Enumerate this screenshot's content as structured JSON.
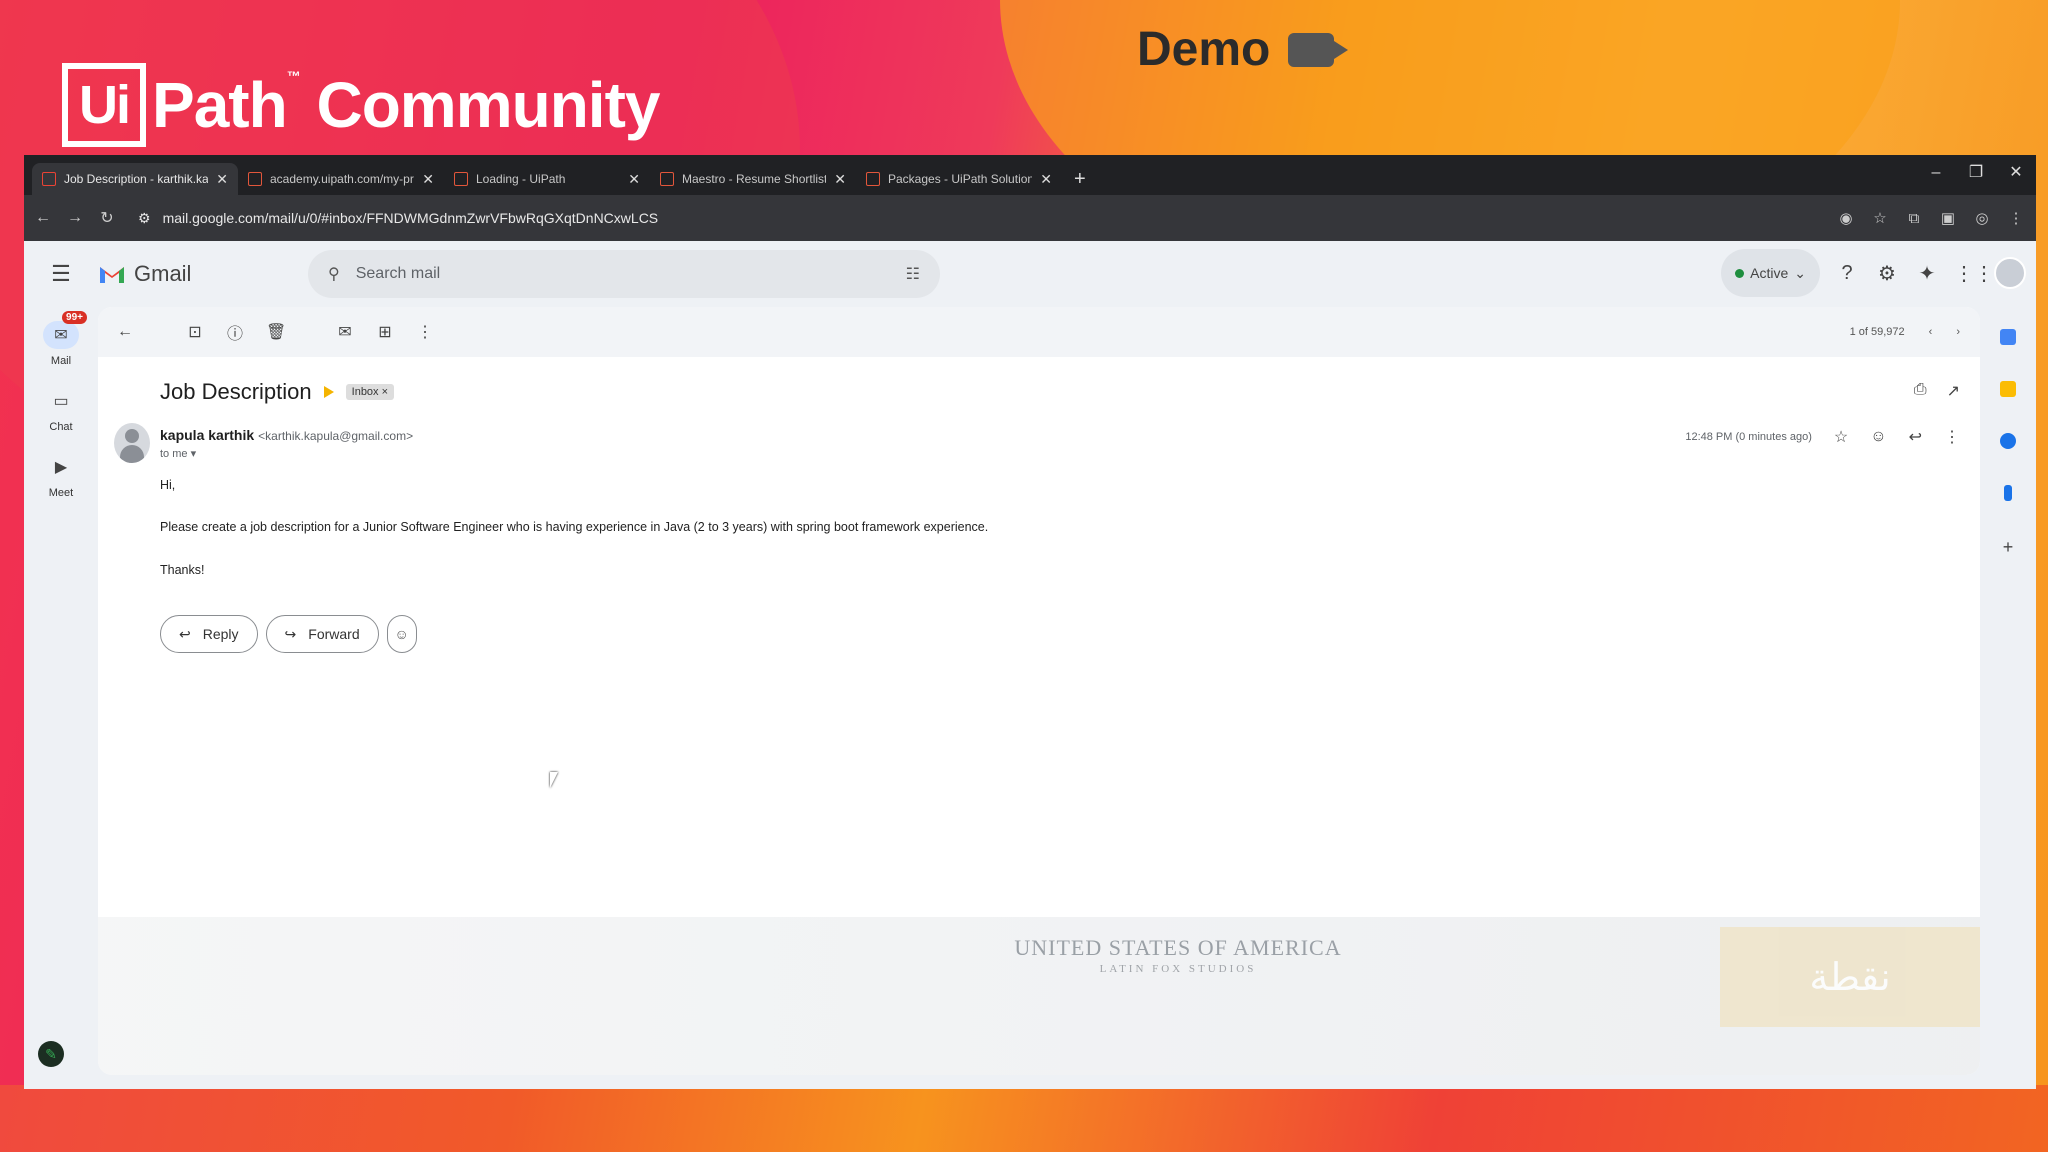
{
  "overlay": {
    "brand_box": "Ui",
    "brand_text": "Path",
    "brand_tm": "™",
    "brand_suffix": "Community",
    "demo_label": "Demo"
  },
  "browser": {
    "tabs": [
      {
        "title": "Job Description - karthik.kapula",
        "active": true
      },
      {
        "title": "academy.uipath.com/my-profile",
        "active": false
      },
      {
        "title": "Loading - UiPath",
        "active": false
      },
      {
        "title": "Maestro - Resume Shortlisting",
        "active": false
      },
      {
        "title": "Packages - UiPath Solution Ma",
        "active": false
      }
    ],
    "url": "mail.google.com/mail/u/0/#inbox/FFNDWMGdnmZwrVFbwRqGXqtDnNCxwLCS"
  },
  "gmail": {
    "app_name": "Gmail",
    "search_placeholder": "Search mail",
    "status": "Active",
    "rail": {
      "mail_label": "Mail",
      "mail_badge": "99+",
      "chat_label": "Chat",
      "meet_label": "Meet"
    },
    "pager": "1 of 59,972",
    "email": {
      "subject": "Job Description",
      "label_chip": "Inbox ×",
      "sender_name": "kapula karthik",
      "sender_email": "<karthik.kapula@gmail.com>",
      "to": "to me",
      "time": "12:48 PM (0 minutes ago)",
      "greeting": "Hi,",
      "body": "Please create a job description for a Junior Software Engineer who is having experience in Java (2 to 3 years) with spring boot framework experience.",
      "signoff": "Thanks!"
    },
    "reply_label": "Reply",
    "forward_label": "Forward"
  },
  "video_overlay": {
    "title": "UNITED STATES OF AMERICA",
    "subtitle": "LATIN FOX STUDIOS",
    "arabic": "نقطة"
  }
}
